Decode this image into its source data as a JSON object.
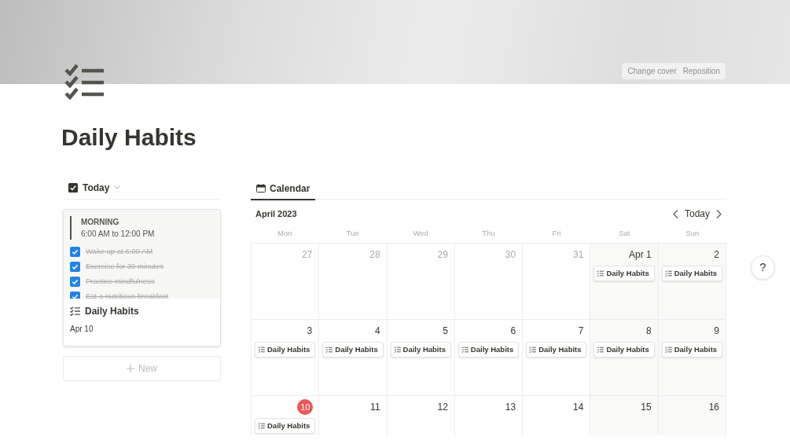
{
  "cover": {
    "buttons": [
      "Change cover",
      "Reposition"
    ]
  },
  "title": "Daily Habits",
  "today_view": {
    "label": "Today",
    "card": {
      "section_label": "MORNING",
      "time": "6:00 AM to 12:00 PM",
      "tasks": [
        {
          "text": "Wake up at 6:00 AM",
          "checked": true
        },
        {
          "text": "Exercise for 30 minutes",
          "checked": true
        },
        {
          "text": "Practice mindfulness",
          "checked": true
        },
        {
          "text": "Eat a nutritious breakfast",
          "checked": true
        }
      ],
      "title": "Daily Habits",
      "date": "Apr 10"
    },
    "new_button": "New"
  },
  "calendar": {
    "tab": "Calendar",
    "month": "April 2023",
    "today_button": "Today",
    "weekdays": [
      "Mon",
      "Tue",
      "Wed",
      "Thu",
      "Fri",
      "Sat",
      "Sun"
    ],
    "weeks": [
      [
        {
          "label": "27",
          "in_month": false,
          "today": false
        },
        {
          "label": "28",
          "in_month": false,
          "today": false
        },
        {
          "label": "29",
          "in_month": false,
          "today": false
        },
        {
          "label": "30",
          "in_month": false,
          "today": false
        },
        {
          "label": "31",
          "in_month": false,
          "today": false
        },
        {
          "label": "Apr 1",
          "in_month": true,
          "today": false,
          "events": [
            "Daily Habits"
          ]
        },
        {
          "label": "2",
          "in_month": true,
          "today": false,
          "events": [
            "Daily Habits"
          ]
        }
      ],
      [
        {
          "label": "3",
          "in_month": true,
          "today": false,
          "events": [
            "Daily Habits"
          ]
        },
        {
          "label": "4",
          "in_month": true,
          "today": false,
          "events": [
            "Daily Habits"
          ]
        },
        {
          "label": "5",
          "in_month": true,
          "today": false,
          "events": [
            "Daily Habits"
          ]
        },
        {
          "label": "6",
          "in_month": true,
          "today": false,
          "events": [
            "Daily Habits"
          ]
        },
        {
          "label": "7",
          "in_month": true,
          "today": false,
          "events": [
            "Daily Habits"
          ]
        },
        {
          "label": "8",
          "in_month": true,
          "today": false,
          "events": [
            "Daily Habits"
          ]
        },
        {
          "label": "9",
          "in_month": true,
          "today": false,
          "events": [
            "Daily Habits"
          ]
        }
      ],
      [
        {
          "label": "10",
          "in_month": true,
          "today": true,
          "events": [
            "Daily Habits"
          ]
        },
        {
          "label": "11",
          "in_month": true,
          "today": false
        },
        {
          "label": "12",
          "in_month": true,
          "today": false
        },
        {
          "label": "13",
          "in_month": true,
          "today": false
        },
        {
          "label": "14",
          "in_month": true,
          "today": false
        },
        {
          "label": "15",
          "in_month": true,
          "today": false
        },
        {
          "label": "16",
          "in_month": true,
          "today": false
        }
      ]
    ]
  },
  "help": "?"
}
